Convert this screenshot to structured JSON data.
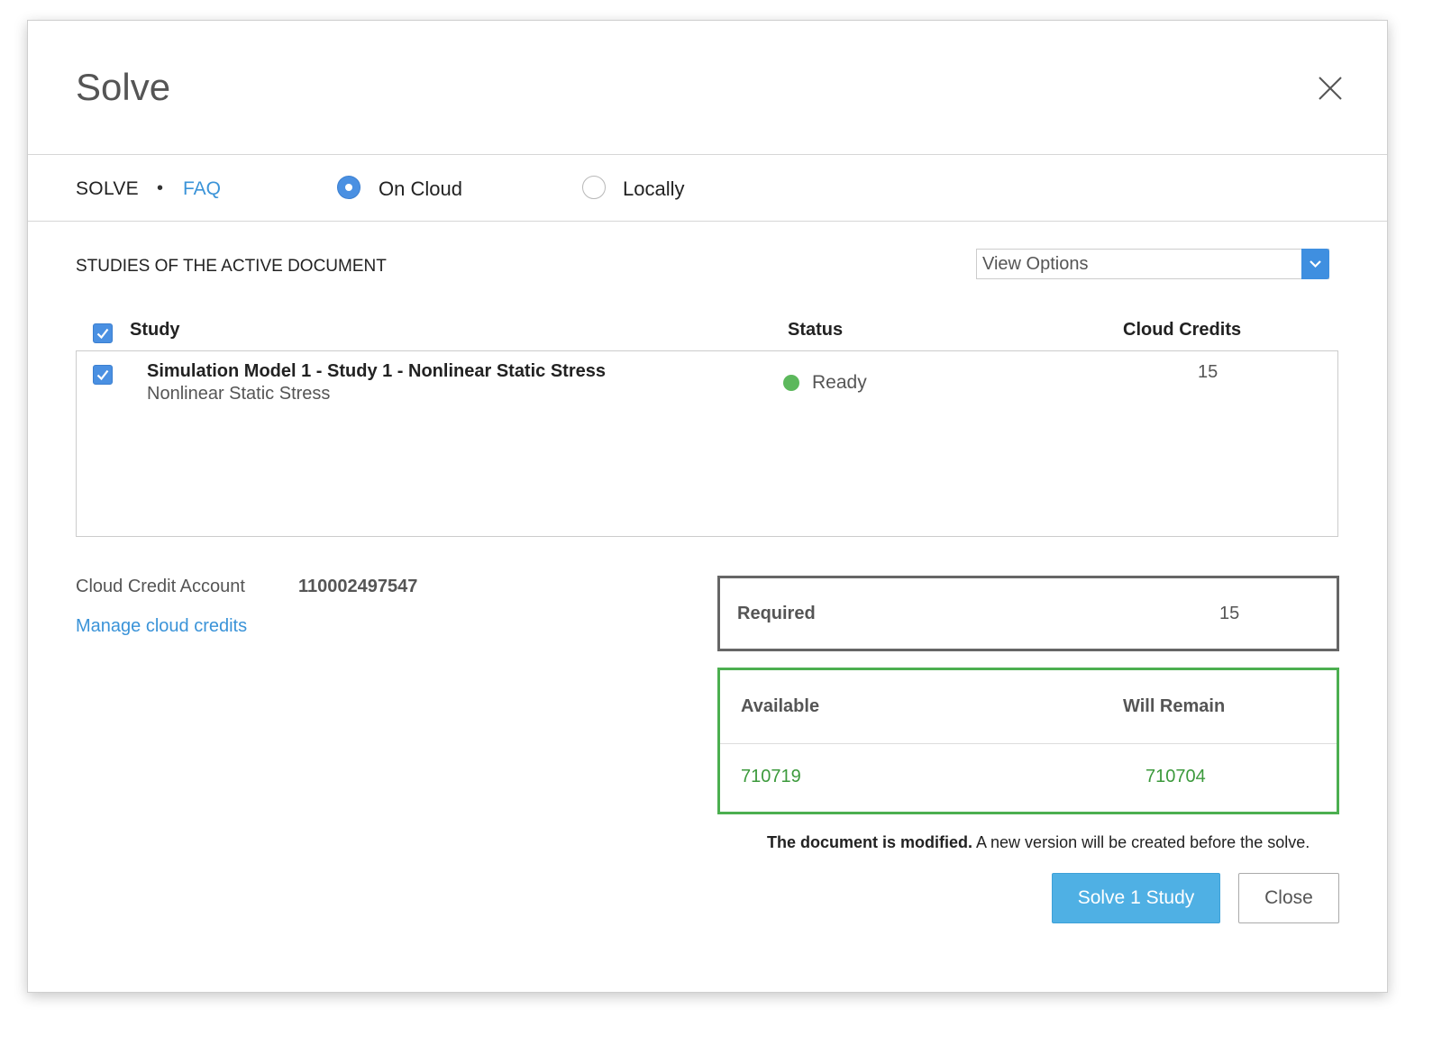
{
  "dialog": {
    "title": "Solve"
  },
  "mode_bar": {
    "solve_label": "SOLVE",
    "separator": "•",
    "faq_link": "FAQ",
    "options": [
      {
        "label": "On Cloud",
        "selected": true
      },
      {
        "label": "Locally",
        "selected": false
      }
    ]
  },
  "studies": {
    "section_title": "STUDIES OF THE ACTIVE DOCUMENT",
    "view_options": {
      "value": "View Options"
    },
    "columns": {
      "study": "Study",
      "status": "Status",
      "credits": "Cloud Credits"
    },
    "select_all_checked": true,
    "rows": [
      {
        "checked": true,
        "title": "Simulation Model 1 - Study 1 - Nonlinear Static Stress",
        "subtitle": "Nonlinear Static Stress",
        "status": "Ready",
        "status_color": "#5cb85c",
        "credits": "15"
      }
    ]
  },
  "account": {
    "label": "Cloud Credit Account",
    "number": "110002497547",
    "manage_link": "Manage cloud credits"
  },
  "summary": {
    "required_label": "Required",
    "required_value": "15",
    "available_label": "Available",
    "will_remain_label": "Will Remain",
    "available_value": "710719",
    "will_remain_value": "710704"
  },
  "notice": {
    "bold": "The document is modified.",
    "text": " A new version will be created before the solve."
  },
  "buttons": {
    "solve": "Solve 1 Study",
    "close": "Close"
  },
  "colors": {
    "accent": "#4a90e2",
    "link": "#3a93d8",
    "primary_button": "#4fb0e4",
    "success": "#4caf50"
  }
}
